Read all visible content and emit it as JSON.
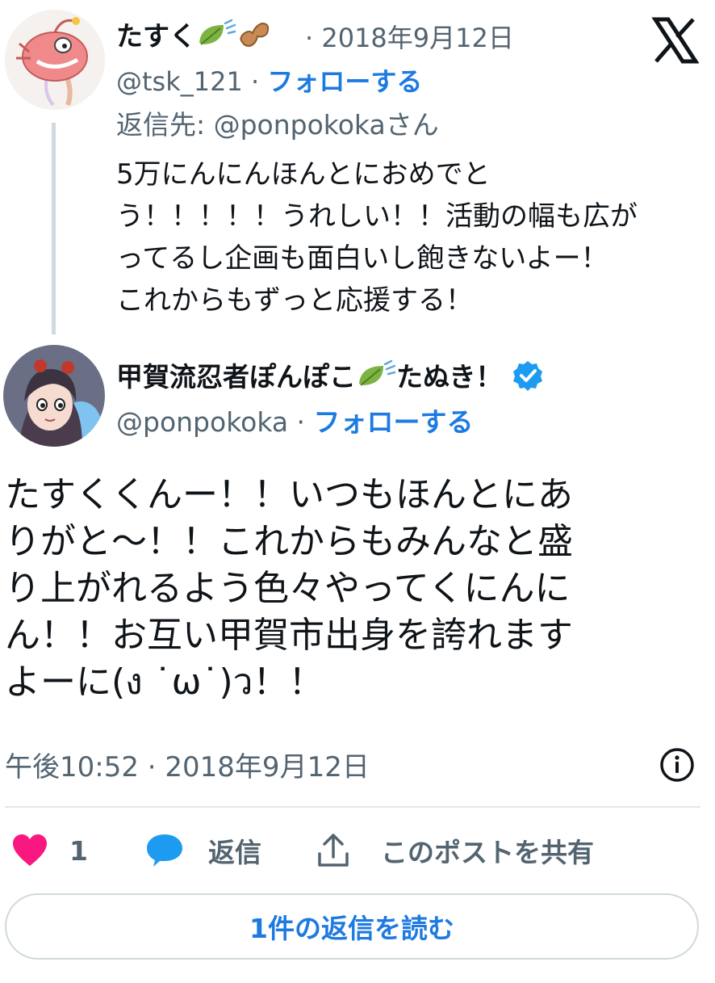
{
  "parent_tweet": {
    "display_name": "たすく",
    "date": "· 2018年9月12日",
    "handle": "@tsk_121 ·",
    "follow_label": "フォローする",
    "reply_prefix": "返信先: ",
    "reply_handle": "@ponpokoka",
    "reply_suffix": "さん",
    "body_lines": [
      "5万にんにんほんとにおめでと",
      "う！！！！！うれしい！！活動の幅も広が",
      "ってるし企画も面白いし飽きないよー！",
      "これからもずっと応援する！"
    ],
    "name_emojis": [
      "leaf-wind-icon",
      "peanut-icon"
    ]
  },
  "main_tweet": {
    "display_name": "甲賀流忍者ぽんぽこ",
    "display_name_suffix": "たぬき！",
    "handle": "@ponpokoka ·",
    "follow_label": "フォローする",
    "verified": true,
    "body_lines": [
      "たすくくんー！！いつもほんとにあ",
      "りがと〜！！これからもみんなと盛",
      "り上がれるよう色々やってくにんに",
      "ん！！お互い甲賀市出身を誇れます",
      "よーに(ง ˙ω˙)ว！！"
    ],
    "timestamp": "午後10:52 · 2018年9月12日"
  },
  "actions": {
    "like_count": "1",
    "reply_label": "返信",
    "share_label": "このポストを共有"
  },
  "read_replies_label": "1件の返信を読む",
  "colors": {
    "accent": "#1d7ae0",
    "like": "#f91880",
    "reply_bubble": "#1d9bf0",
    "muted": "#536471",
    "verified": "#1d9bf0"
  }
}
